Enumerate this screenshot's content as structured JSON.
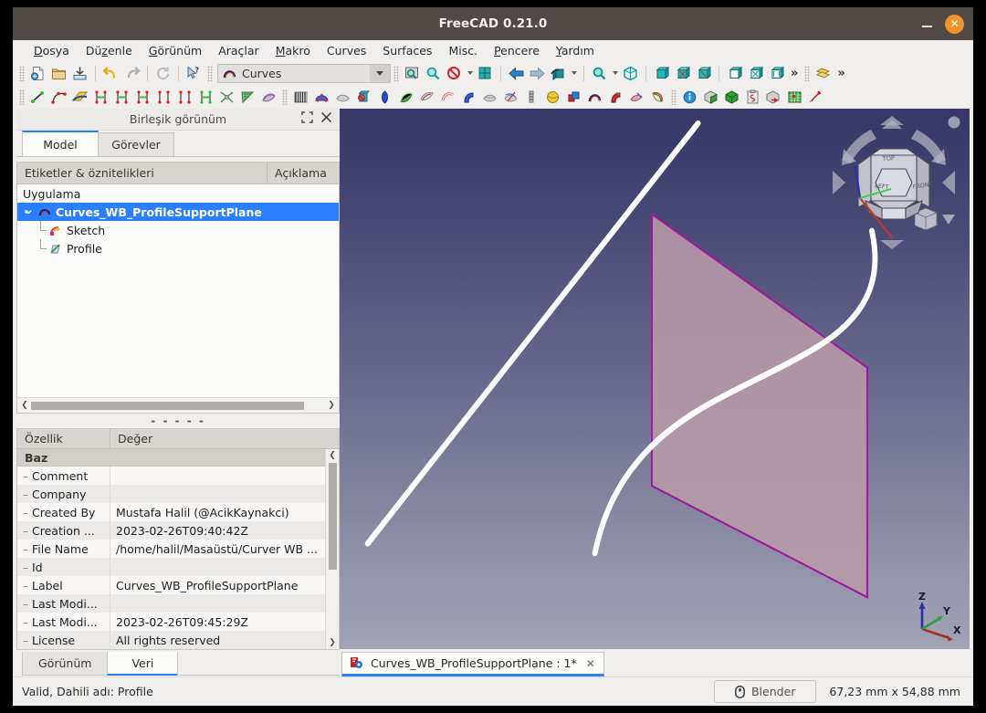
{
  "window": {
    "title": "FreeCAD 0.21.0",
    "minimize_label": "–",
    "close_label": "✕"
  },
  "menubar": [
    {
      "label": "Dosya",
      "mnemonic": "D"
    },
    {
      "label": "Düzenle",
      "mnemonic": "z"
    },
    {
      "label": "Görünüm",
      "mnemonic": "G"
    },
    {
      "label": "Araçlar",
      "mnemonic": ""
    },
    {
      "label": "Makro",
      "mnemonic": "M"
    },
    {
      "label": "Curves",
      "mnemonic": ""
    },
    {
      "label": "Surfaces",
      "mnemonic": ""
    },
    {
      "label": "Misc.",
      "mnemonic": ""
    },
    {
      "label": "Pencere",
      "mnemonic": "P"
    },
    {
      "label": "Yardım",
      "mnemonic": "Y"
    }
  ],
  "toolbar": {
    "workbench_selected": "Curves",
    "overflow_label": "»",
    "file_icons": [
      "new-document-icon",
      "open-folder-icon",
      "save-icon"
    ],
    "edit_icons": [
      "undo-icon",
      "redo-icon",
      "refresh-icon",
      "whats-this-icon"
    ],
    "view_icons": [
      "fit-all-icon",
      "zoom-box-icon",
      "draw-style-icon",
      "fit-selection-icon"
    ],
    "nav_icons": [
      "back-arrow-icon",
      "forward-arrow-icon",
      "isometric-view-icon",
      "zoom-icon",
      "axonometric-icon"
    ],
    "std_view_icons": [
      "front-view-icon",
      "top-view-icon",
      "right-view-icon",
      "rear-view-icon",
      "bottom-view-icon",
      "left-view-icon"
    ],
    "curves_icons": [
      "line-icon",
      "bspline-icon",
      "gordon-surface-icon",
      "join-curve-icon",
      "discretize-icon",
      "interpolate-icon",
      "approximate-icon",
      "parametric-blend-icon",
      "curve-extend-icon",
      "curve-on-surface-icon",
      "mixed-curve-icon",
      "blend-surface-icon"
    ],
    "surfaces_icons": [
      "zebra-stripes-icon",
      "iso-curve-icon",
      "sketch-on-surface-icon",
      "pipeshell-icon",
      "profile-support-icon",
      "sweep-icon",
      "flatten-face-icon",
      "segment-surface-icon",
      "tube-icon",
      "blender-tool-icon",
      "info-icon",
      "solid-icon",
      "green-cube-icon",
      "sketch-clipboard-icon",
      "cube-arrow-icon",
      "grid-icon",
      "misc-icon"
    ]
  },
  "left_panel": {
    "dock_title": "Birleşik görünüm",
    "dock_float_icon": "restore-icon",
    "dock_close_icon": "close-icon",
    "tabs": [
      {
        "label": "Model",
        "active": true
      },
      {
        "label": "Görevler",
        "active": false
      }
    ],
    "tree": {
      "columns": [
        "Etiketler & öznitelikleri",
        "Açıklama"
      ],
      "nodes": [
        {
          "label": "Uygulama",
          "level": 0,
          "selected": false,
          "icon": "",
          "expander": false
        },
        {
          "label": "Curves_WB_ProfileSupportPlane",
          "level": 1,
          "selected": true,
          "icon": "document-icon",
          "expander": true
        },
        {
          "label": "Sketch",
          "level": 2,
          "selected": false,
          "icon": "sketch-icon",
          "expander": false
        },
        {
          "label": "Profile",
          "level": 2,
          "selected": false,
          "icon": "profile-icon",
          "expander": false
        }
      ]
    },
    "splitter_glyph": "- - - - -",
    "properties": {
      "columns": [
        "Özellik",
        "Değer"
      ],
      "group": "Baz",
      "rows": [
        {
          "name": "Comment",
          "value": ""
        },
        {
          "name": "Company",
          "value": ""
        },
        {
          "name": "Created By",
          "value": "Mustafa Halil (@AcikKaynakci)"
        },
        {
          "name": "Creation ...",
          "value": "2023-02-26T09:40:42Z"
        },
        {
          "name": "File Name",
          "value": "/home/halil/Masaüstü/Curver WB ..."
        },
        {
          "name": "Id",
          "value": ""
        },
        {
          "name": "Label",
          "value": "Curves_WB_ProfileSupportPlane"
        },
        {
          "name": "Last Modi...",
          "value": ""
        },
        {
          "name": "Last Modi...",
          "value": "2023-02-26T09:45:29Z"
        },
        {
          "name": "License",
          "value": "All rights reserved"
        }
      ]
    },
    "bottom_tabs": [
      {
        "label": "Görünüm",
        "active": false
      },
      {
        "label": "Veri",
        "active": true
      }
    ]
  },
  "document_tab": {
    "icon": "freecad-document-icon",
    "label": "Curves_WB_ProfileSupportPlane  : 1*",
    "close_label": "✕"
  },
  "statusbar": {
    "message": "Valid, Dahili adı: Profile",
    "blender_button": "Blender",
    "blender_icon": "mouse-icon",
    "dimensions": "67,23 mm x 54,88 mm"
  },
  "viewport": {
    "background_top": "#373766",
    "background_bottom": "#a3a3b6",
    "plane_fill": "#b99aa8",
    "plane_edge": "#a0189e",
    "curve_color": "#ffffff",
    "navcube_label": "navigation-cube",
    "axis_labels": [
      "Z",
      "Y",
      "X"
    ],
    "axis_colors": {
      "x": "#c0392b",
      "y": "#27ae60",
      "z": "#2a3c9e"
    }
  }
}
